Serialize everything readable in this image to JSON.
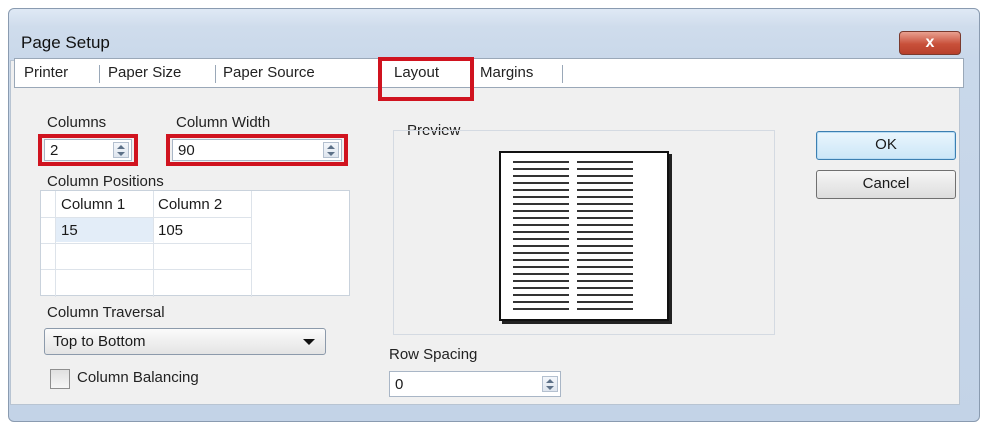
{
  "window": {
    "title": "Page Setup",
    "close_label": "x"
  },
  "tabs": [
    "Printer",
    "Paper Size",
    "Paper Source",
    "Layout",
    "Margins"
  ],
  "columns": {
    "label": "Columns",
    "value": "2"
  },
  "column_width": {
    "label": "Column Width",
    "value": "90"
  },
  "column_positions": {
    "label": "Column Positions",
    "headers": [
      "Column 1",
      "Column 2"
    ],
    "rows": [
      [
        "15",
        "105"
      ]
    ]
  },
  "column_traversal": {
    "label": "Column Traversal",
    "value": "Top to Bottom"
  },
  "column_balancing": {
    "label": "Column Balancing",
    "checked": false
  },
  "preview": {
    "label": "Preview",
    "columns": 2
  },
  "row_spacing": {
    "label": "Row Spacing",
    "value": "0"
  },
  "buttons": {
    "ok": "OK",
    "cancel": "Cancel"
  },
  "highlight_color": "#d0131f"
}
